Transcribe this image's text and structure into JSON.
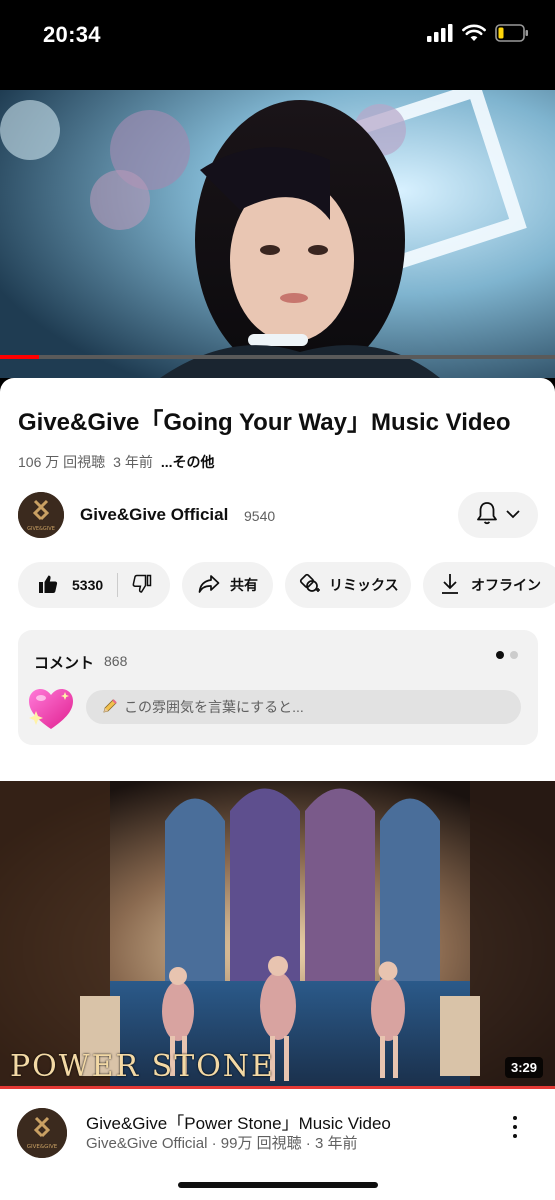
{
  "status_bar": {
    "time": "20:34",
    "icons": [
      "signal-icon",
      "wifi-icon",
      "battery-icon"
    ]
  },
  "player": {
    "progress_fraction": 0.07,
    "accent": "#ff0000"
  },
  "video": {
    "title": "Give&Give「Going Your Way」Music Video",
    "views": "106 万 回視聴",
    "age": "3 年前",
    "more_label": "...その他"
  },
  "channel": {
    "name": "Give&Give Official",
    "subscribers": "9540",
    "avatar_text": "GIVE&GIVE"
  },
  "actions": {
    "like_count": "5330",
    "share_label": "共有",
    "remix_label": "リミックス",
    "offline_label": "オフライン"
  },
  "comments": {
    "title": "コメント",
    "count": "868",
    "placeholder": "この雰囲気を言葉にすると..."
  },
  "next_video": {
    "overlay_text": "POWER STONE",
    "duration": "3:29",
    "title": "Give&Give「Power Stone」Music Video",
    "meta": "Give&Give Official · 99万 回視聴 · 3 年前",
    "avatar_text": "GIVE&GIVE"
  }
}
